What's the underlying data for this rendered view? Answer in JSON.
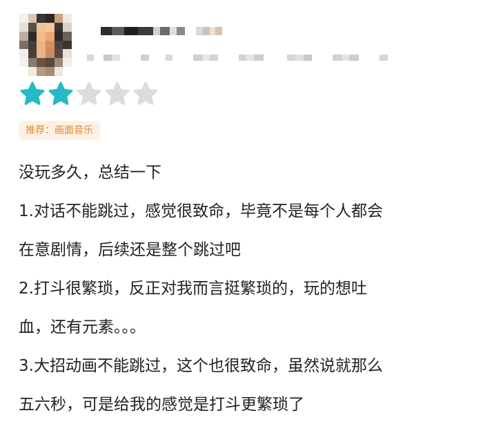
{
  "colors": {
    "star_filled": "#26b9c6",
    "star_empty": "#dcdcdc",
    "tag_bg": "#fdf1e3",
    "tag_text": "#e38a2c",
    "body_text": "#222222"
  },
  "avatar": {
    "icon": "user-avatar-icon",
    "pixelated": true
  },
  "rating": {
    "value": 2,
    "max": 5
  },
  "tag": {
    "label": "推荐：画面音乐"
  },
  "review": {
    "lines": [
      "没玩多久，总结一下",
      "1.对话不能跳过，感觉很致命，毕竟不是每个人都会",
      "在意剧情，后续还是整个跳过吧",
      "2.打斗很繁琐，反正对我而言挺繁琐的，玩的想吐",
      "血，还有元素。。。",
      "3.大招动画不能跳过，这个也很致命，虽然说就那么",
      "五六秒，可是给我的感觉是打斗更繁琐了"
    ]
  }
}
